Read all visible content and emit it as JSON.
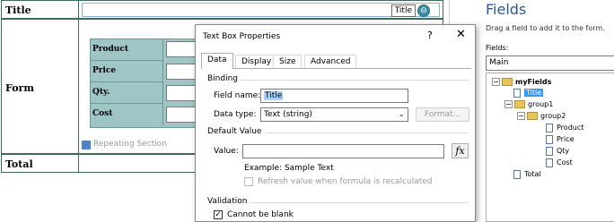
{
  "form": {
    "rows": {
      "title": "Title",
      "form": "Form",
      "total": "Total"
    },
    "title_control_tag": "Title",
    "repeating_section": {
      "fields": [
        "Product",
        "Price",
        "Qty.",
        "Cost"
      ],
      "tag": "Repeating Section"
    }
  },
  "fields_pane": {
    "title": "Fields",
    "hint": "Drag a field to add it to the form.",
    "fields_label": "Fields:",
    "data_source": "Main",
    "tree": [
      {
        "label": "myFields",
        "kind": "folder",
        "expander": "−",
        "level": 0,
        "bold": true
      },
      {
        "label": "Title",
        "kind": "field",
        "level": 1,
        "selected": true
      },
      {
        "label": "group1",
        "kind": "folder",
        "expander": "−",
        "level": 1
      },
      {
        "label": "group2",
        "kind": "folder",
        "expander": "−",
        "level": 2
      },
      {
        "label": "Product",
        "kind": "field",
        "level": 3
      },
      {
        "label": "Price",
        "kind": "field",
        "level": 3
      },
      {
        "label": "Qty",
        "kind": "field",
        "level": 3
      },
      {
        "label": "Cost",
        "kind": "field",
        "level": 3
      },
      {
        "label": "Total",
        "kind": "field",
        "level": 1
      }
    ]
  },
  "dialog": {
    "title": "Text Box Properties",
    "help": "?",
    "close": "✕",
    "tabs": [
      "Data",
      "Display",
      "Size",
      "Advanced"
    ],
    "active_tab": "Data",
    "binding": {
      "heading": "Binding",
      "field_name_label": "Field name:",
      "field_name_value": "Title",
      "data_type_label": "Data type:",
      "data_type_value": "Text (string)",
      "format_button": "Format..."
    },
    "default_value": {
      "heading": "Default Value",
      "value_label": "Value:",
      "value": "",
      "fx_button": "fx",
      "example": "Example: Sample Text",
      "refresh_label": "Refresh value when formula is recalculated"
    },
    "validation": {
      "heading": "Validation",
      "cannot_be_blank_label": "Cannot be blank"
    }
  }
}
